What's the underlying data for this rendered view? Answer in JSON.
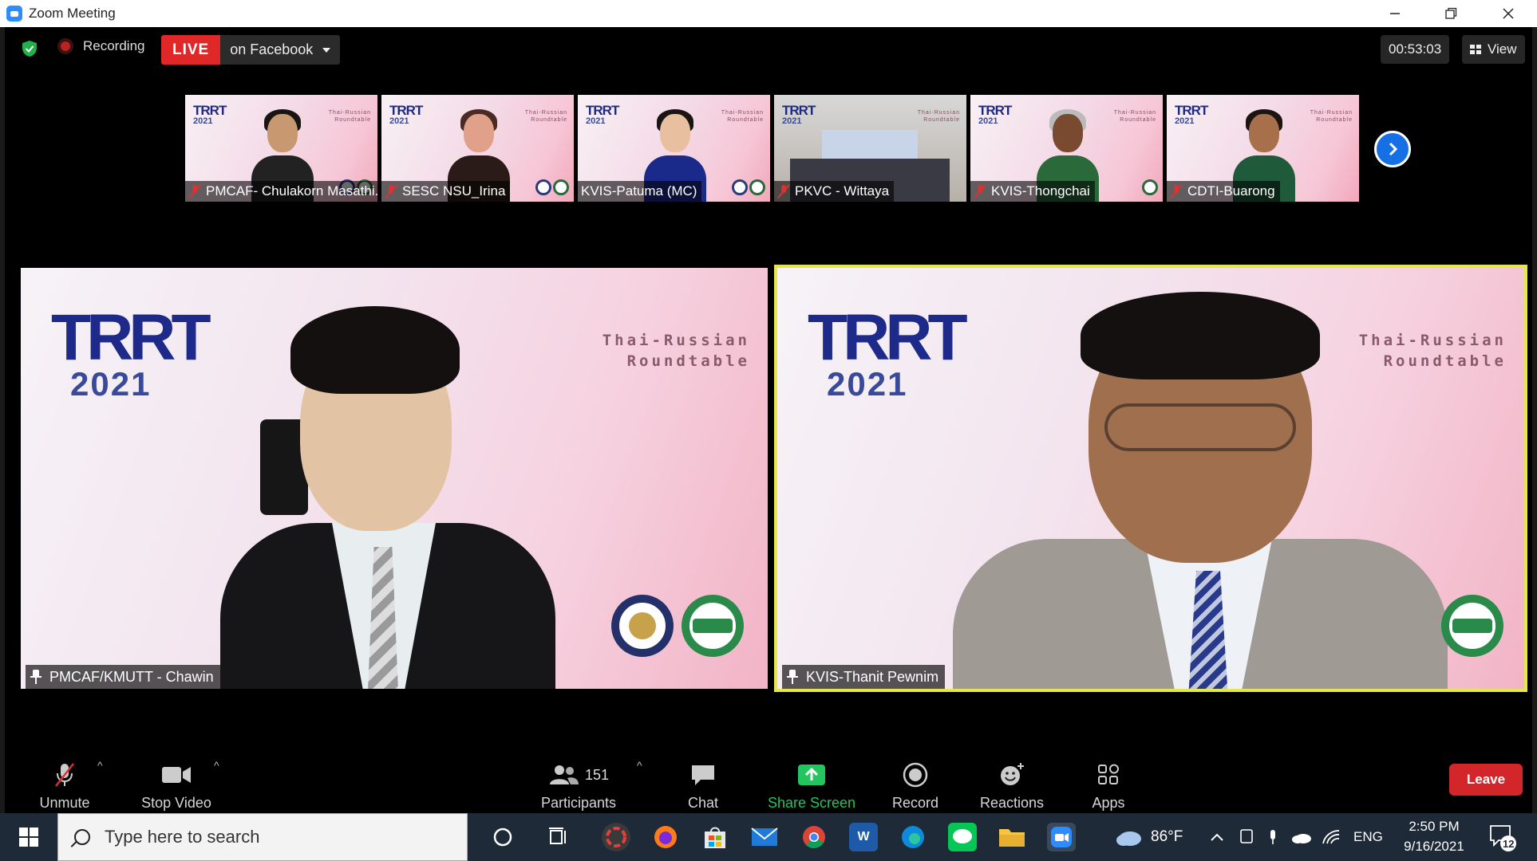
{
  "window": {
    "title": "Zoom Meeting"
  },
  "topbar": {
    "recording_label": "Recording",
    "live_tag": "LIVE",
    "live_destination": "on Facebook",
    "timer": "00:53:03",
    "view_label": "View"
  },
  "thumbnails": [
    {
      "name": "PMCAF- Chulakorn Masathi...",
      "muted": true
    },
    {
      "name": "SESC NSU_Irina",
      "muted": true
    },
    {
      "name": "KVIS-Patuma (MC)",
      "muted": false
    },
    {
      "name": "PKVC - Wittaya",
      "muted": true
    },
    {
      "name": "KVIS-Thongchai",
      "muted": true
    },
    {
      "name": "CDTI-Buarong",
      "muted": true
    }
  ],
  "main_tiles": [
    {
      "name": "PMCAF/KMUTT - Chawin",
      "active": false
    },
    {
      "name": "KVIS-Thanit Pewnim",
      "active": true
    }
  ],
  "backdrop": {
    "logo_top": "TRRT",
    "logo_year": "2021",
    "roundtable_line1": "Thai-Russian",
    "roundtable_line2": "Roundtable"
  },
  "toolbar": {
    "unmute": "Unmute",
    "stop_video": "Stop Video",
    "participants": "Participants",
    "participants_count": "151",
    "chat": "Chat",
    "share_screen": "Share Screen",
    "record": "Record",
    "reactions": "Reactions",
    "apps": "Apps",
    "leave": "Leave"
  },
  "taskbar": {
    "search_placeholder": "Type here to search",
    "weather": "86°F",
    "language": "ENG",
    "time": "2:50 PM",
    "date": "9/16/2021",
    "notifications": "12"
  },
  "colors": {
    "accent": "#2d8cff",
    "live_red": "#e02828",
    "share_green": "#22c55e",
    "leave_red": "#d3262a",
    "active_speaker": "#e6e84a"
  }
}
